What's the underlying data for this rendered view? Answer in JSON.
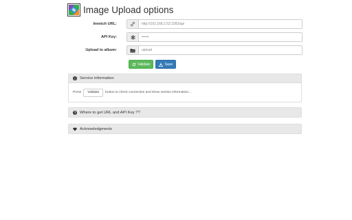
{
  "header": {
    "title": "Image Upload options"
  },
  "form": {
    "url": {
      "label": "Immich URL:",
      "placeholder": "http://192.168.2.52:2283/api",
      "value": "",
      "icon": "link-icon"
    },
    "apikey": {
      "label": "API Key:",
      "placeholder": "••••••",
      "value": "",
      "icon": "asterisk-icon"
    },
    "album": {
      "label": "Upload to album:",
      "placeholder": "upload",
      "value": "",
      "icon": "folder-icon"
    }
  },
  "buttons": {
    "validate_label": "Validate",
    "save_label": "Save"
  },
  "panels": {
    "service": {
      "title": "Service information",
      "body_prefix": "Press",
      "body_button": "Validate",
      "body_suffix": "button to check connection and show version information..."
    },
    "where": {
      "title": "Where to get URL and API Key ??"
    },
    "ack": {
      "title": "Acknowledgments"
    }
  },
  "colors": {
    "success": "#5cb85c",
    "primary": "#337ab7",
    "panel_heading": "#e8e8e8",
    "logo_green": "#2eaf4e",
    "logo_orange": "#f08a24",
    "logo_purple": "#7a4db0",
    "logo_blue": "#3b8ed8"
  }
}
